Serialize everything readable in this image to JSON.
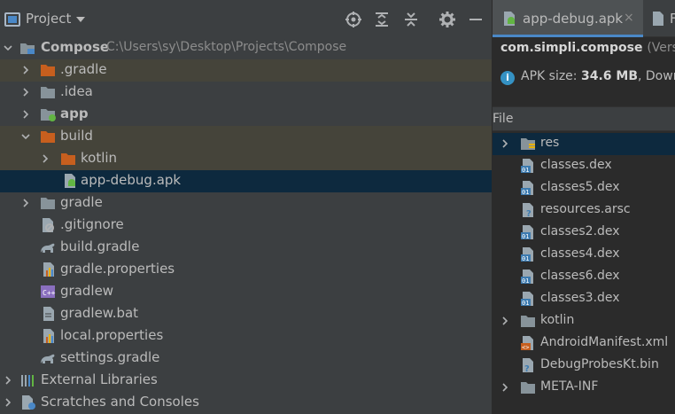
{
  "project_panel": {
    "title": "Project",
    "toolbar": [
      "locate-icon",
      "expand-all-icon",
      "collapse-all-icon",
      "gear-icon",
      "hide-icon"
    ],
    "tree": [
      {
        "label": "Compose",
        "path": "C:\\Users\\sy\\Desktop\\Projects\\Compose",
        "icon": "module-folder-icon",
        "expanded": true,
        "bold": true
      },
      {
        "label": ".gradle",
        "icon": "orange-folder-icon",
        "expanded": false
      },
      {
        "label": ".idea",
        "icon": "folder-icon",
        "expanded": false
      },
      {
        "label": "app",
        "icon": "android-module-icon",
        "expanded": false,
        "bold": true
      },
      {
        "label": "build",
        "icon": "orange-folder-icon",
        "expanded": true
      },
      {
        "label": "kotlin",
        "icon": "orange-folder-icon",
        "expanded": false
      },
      {
        "label": "app-debug.apk",
        "icon": "apk-file-icon",
        "selected": true
      },
      {
        "label": "gradle",
        "icon": "folder-icon",
        "expanded": false
      },
      {
        "label": ".gitignore",
        "icon": "gitignore-file-icon"
      },
      {
        "label": "build.gradle",
        "icon": "gradle-file-icon"
      },
      {
        "label": "gradle.properties",
        "icon": "properties-file-icon"
      },
      {
        "label": "gradlew",
        "icon": "shell-script-icon"
      },
      {
        "label": "gradlew.bat",
        "icon": "batch-file-icon"
      },
      {
        "label": "local.properties",
        "icon": "properties-file-icon"
      },
      {
        "label": "settings.gradle",
        "icon": "gradle-file-icon"
      },
      {
        "label": "External Libraries",
        "icon": "libraries-icon",
        "expanded": false
      },
      {
        "label": "Scratches and Consoles",
        "icon": "scratches-icon",
        "expanded": false
      }
    ]
  },
  "apk_panel": {
    "tab_label": "app-debug.apk",
    "tab_close": "×",
    "second_tab_label": "F",
    "package_name": "com.simpli.compose",
    "package_version": "(Version",
    "apk_size_label": "APK size:",
    "apk_size_value": "34.6 MB",
    "apk_size_suffix": ", Down",
    "file_column_header": "File",
    "files": [
      {
        "label": "res",
        "icon": "res-folder-icon",
        "expandable": true,
        "selected": true
      },
      {
        "label": "classes.dex",
        "icon": "dex-file-icon"
      },
      {
        "label": "classes5.dex",
        "icon": "dex-file-icon"
      },
      {
        "label": "resources.arsc",
        "icon": "arsc-file-icon"
      },
      {
        "label": "classes2.dex",
        "icon": "dex-file-icon"
      },
      {
        "label": "classes4.dex",
        "icon": "dex-file-icon"
      },
      {
        "label": "classes6.dex",
        "icon": "dex-file-icon"
      },
      {
        "label": "classes3.dex",
        "icon": "dex-file-icon"
      },
      {
        "label": "kotlin",
        "icon": "folder-icon",
        "expandable": true
      },
      {
        "label": "AndroidManifest.xml",
        "icon": "manifest-file-icon"
      },
      {
        "label": "DebugProbesKt.bin",
        "icon": "bin-file-icon"
      },
      {
        "label": "META-INF",
        "icon": "folder-icon",
        "expandable": true
      }
    ]
  },
  "colors": {
    "panel_bg": "#3c3f41",
    "editor_bg": "#2b2b2b",
    "selection": "#0d293e",
    "excluded_highlight": "#45443a",
    "accent_blue": "#4a88c7",
    "folder_orange": "#c75f1e"
  }
}
